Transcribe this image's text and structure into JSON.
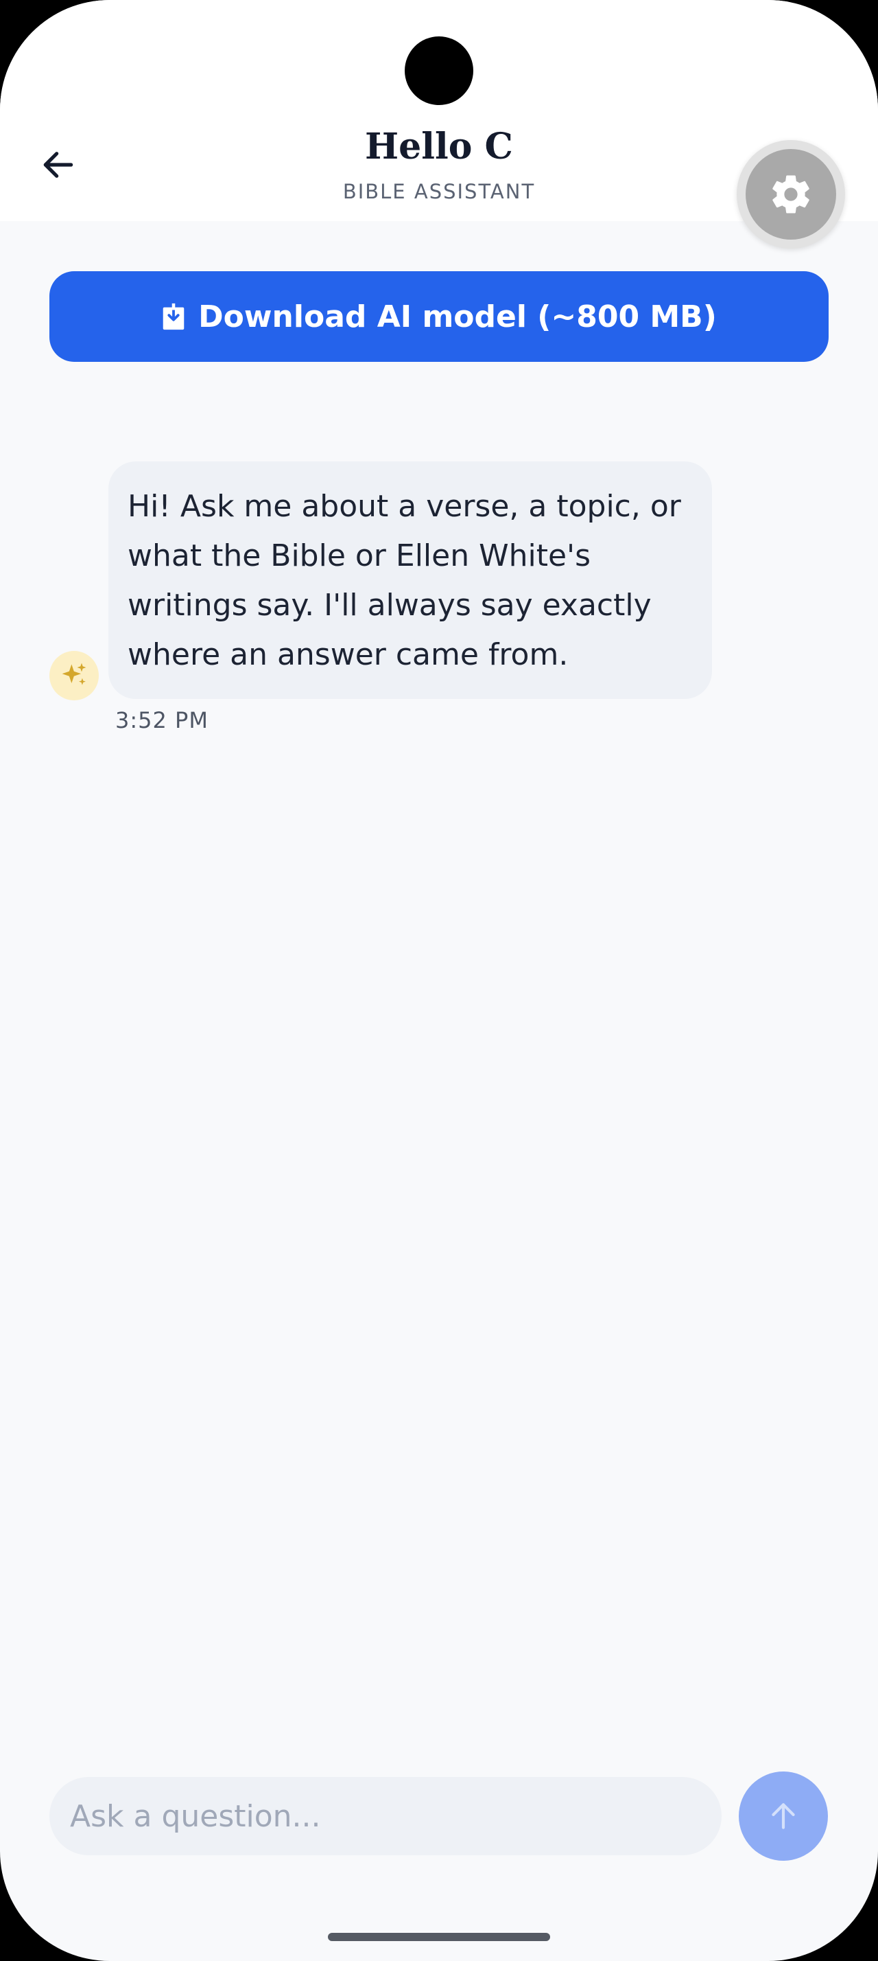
{
  "header": {
    "title": "Hello C",
    "subtitle": "BIBLE ASSISTANT",
    "back_icon": "arrow-left-icon",
    "settings_icon": "gear-icon"
  },
  "download": {
    "label": "Download AI model (~800 MB)",
    "icon": "download-icon"
  },
  "messages": [
    {
      "sender": "assistant",
      "avatar_icon": "sparkles-icon",
      "text": "Hi! Ask me about a verse, a topic, or what the Bible or Ellen White's writings say. I'll always say exactly where an answer came from.",
      "time": "3:52 PM"
    }
  ],
  "composer": {
    "placeholder": "Ask a question...",
    "value": "",
    "send_icon": "arrow-up-icon"
  },
  "colors": {
    "primary": "#2563eb",
    "send_disabled": "#8eacf5",
    "assistant_bubble": "#eef1f6",
    "avatar_bg": "#fcefc4",
    "accent_gold": "#d4a72c",
    "background": "#f8f9fb"
  }
}
